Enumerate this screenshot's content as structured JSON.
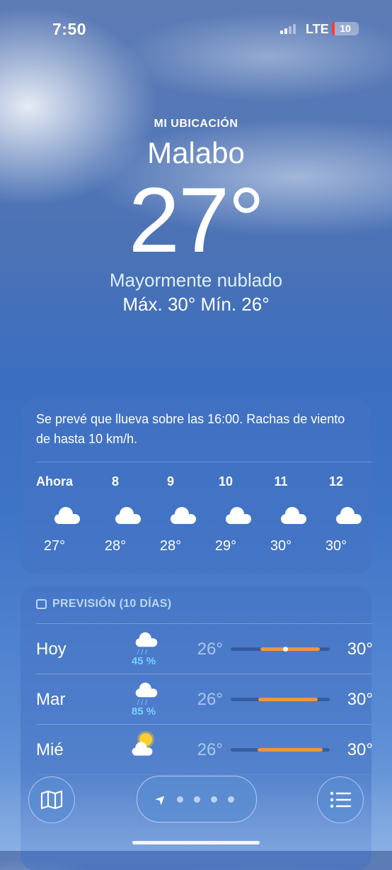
{
  "status": {
    "time": "7:50",
    "network": "LTE",
    "battery": "10"
  },
  "header": {
    "location_label": "MI UBICACIÓN",
    "city": "Malabo",
    "temperature": "27°",
    "condition": "Mayormente nublado",
    "hilo": "Máx. 30°  Mín. 26°"
  },
  "hourly": {
    "summary": "Se prevé que llueva sobre las 16:00. Rachas de viento de hasta 10 km/h.",
    "hours": [
      {
        "label": "Ahora",
        "icon": "cloud-icon",
        "temp": "27°"
      },
      {
        "label": "8",
        "icon": "cloud-icon",
        "temp": "28°"
      },
      {
        "label": "9",
        "icon": "cloud-icon",
        "temp": "28°"
      },
      {
        "label": "10",
        "icon": "cloud-icon",
        "temp": "29°"
      },
      {
        "label": "11",
        "icon": "cloud-icon",
        "temp": "30°"
      },
      {
        "label": "12",
        "icon": "cloud-icon",
        "temp": "30°"
      }
    ]
  },
  "daily": {
    "title": "PREVISIÓN (10 DÍAS)",
    "days": [
      {
        "day": "Hoy",
        "icon": "cloud-rain-icon",
        "precip": "45 %",
        "low": "26°",
        "high": "30°",
        "range_start": 0.3,
        "range_end": 0.9,
        "current": 0.55
      },
      {
        "day": "Mar",
        "icon": "cloud-rain-icon",
        "precip": "85 %",
        "low": "26°",
        "high": "30°",
        "range_start": 0.28,
        "range_end": 0.88
      },
      {
        "day": "Mié",
        "icon": "sun-cloud-icon",
        "precip": "",
        "low": "26°",
        "high": "30°",
        "range_start": 0.27,
        "range_end": 0.93
      }
    ]
  },
  "colors": {
    "precip": "#78d3ff",
    "range_bar": "#f0953b",
    "battery_low": "#ff3b30"
  }
}
